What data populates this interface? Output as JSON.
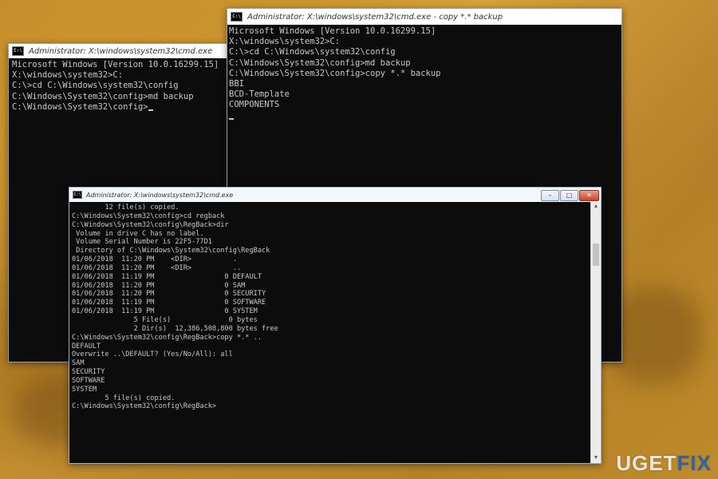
{
  "windows": [
    {
      "title": "Administrator: X:\\windows\\system32\\cmd.exe",
      "icon": "C:\\",
      "lines": [
        "Microsoft Windows [Version 10.0.16299.15]",
        "",
        "X:\\windows\\system32>C:",
        "",
        "C:\\>cd C:\\Windows\\system32\\config",
        "",
        "C:\\Windows\\System32\\config>md backup",
        "",
        "C:\\Windows\\System32\\config>"
      ]
    },
    {
      "title": "Administrator: X:\\windows\\system32\\cmd.exe - copy  *.* backup",
      "icon": "C:\\",
      "lines": [
        "Microsoft Windows [Version 10.0.16299.15]",
        "",
        "X:\\windows\\system32>C:",
        "",
        "C:\\>cd C:\\Windows\\system32\\config",
        "",
        "C:\\Windows\\System32\\config>md backup",
        "",
        "C:\\Windows\\System32\\config>copy *.* backup",
        "BBI",
        "BCD-Template",
        "COMPONENTS"
      ]
    },
    {
      "title": "Administrator: X:\\windows\\system32\\cmd.exe",
      "icon": "C:\\",
      "buttons": {
        "minimize": "–",
        "maximize": "□",
        "close": "✕"
      },
      "lines": [
        "        12 file(s) copied.",
        "",
        "C:\\Windows\\System32\\config>cd regback",
        "",
        "C:\\Windows\\System32\\config\\RegBack>dir",
        " Volume in drive C has no label.",
        " Volume Serial Number is 22F5-77D1",
        "",
        " Directory of C:\\Windows\\System32\\config\\RegBack",
        "",
        "01/06/2018  11:20 PM    <DIR>          .",
        "01/06/2018  11:20 PM    <DIR>          ..",
        "01/06/2018  11:19 PM                 0 DEFAULT",
        "01/06/2018  11:20 PM                 0 SAM",
        "01/06/2018  11:20 PM                 0 SECURITY",
        "01/06/2018  11:19 PM                 0 SOFTWARE",
        "01/06/2018  11:19 PM                 0 SYSTEM",
        "               5 File(s)              0 bytes",
        "               2 Dir(s)  12,386,508,800 bytes free",
        "",
        "C:\\Windows\\System32\\config\\RegBack>copy *.* ..",
        "DEFAULT",
        "Overwrite ..\\DEFAULT? (Yes/No/All): all",
        "SAM",
        "SECURITY",
        "SOFTWARE",
        "SYSTEM",
        "        5 file(s) copied.",
        "",
        "C:\\Windows\\System32\\config\\RegBack>"
      ]
    }
  ],
  "watermark": {
    "prefix": "U",
    "middle": "GET",
    "suffix": "FIX"
  },
  "colors": {
    "console_bg": "#0c0c0c",
    "console_text": "#c8c8c8",
    "background": "#c08a2c",
    "watermark_fix": "#2c64a8"
  }
}
